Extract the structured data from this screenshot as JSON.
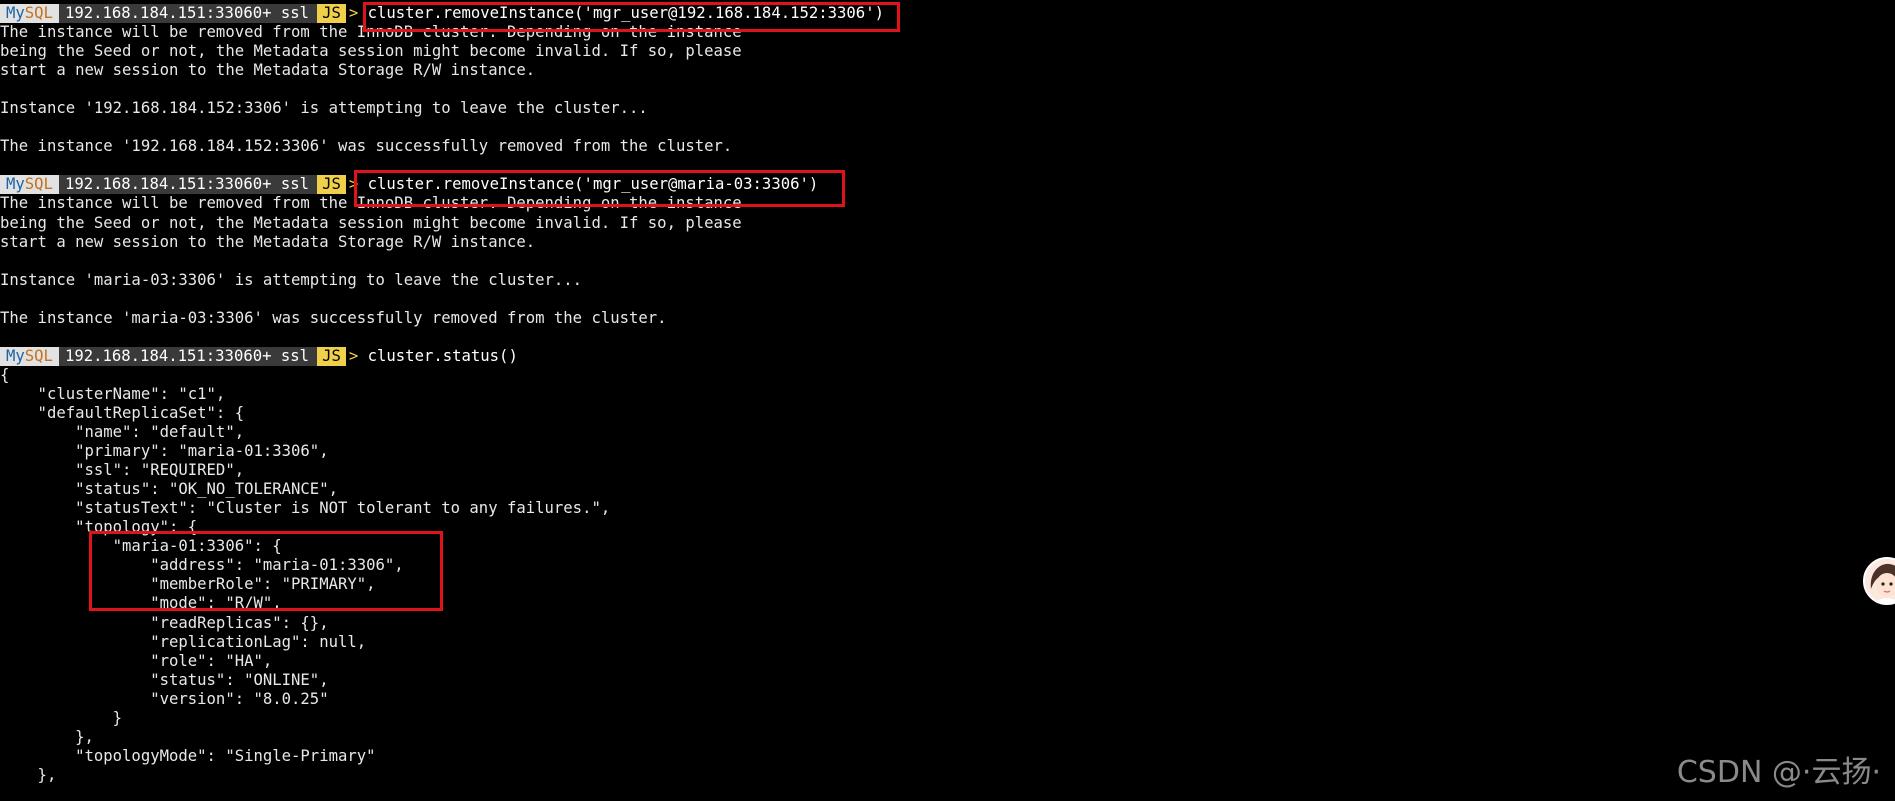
{
  "prompt": {
    "my": "My",
    "sql": "SQL",
    "host": "192.168.184.151:33060+ ssl",
    "lang": "JS",
    "arrow": ">"
  },
  "blocks": [
    {
      "command": " cluster.removeInstance('mgr_user@192.168.184.152:3306')",
      "output": [
        "The instance will be removed from the InnoDB cluster. Depending on the instance",
        "being the Seed or not, the Metadata session might become invalid. If so, please",
        "start a new session to the Metadata Storage R/W instance.",
        "",
        "Instance '192.168.184.152:3306' is attempting to leave the cluster...",
        "",
        "The instance '192.168.184.152:3306' was successfully removed from the cluster.",
        ""
      ]
    },
    {
      "command": " cluster.removeInstance('mgr_user@maria-03:3306')",
      "output": [
        "The instance will be removed from the InnoDB cluster. Depending on the instance",
        "being the Seed or not, the Metadata session might become invalid. If so, please",
        "start a new session to the Metadata Storage R/W instance.",
        "",
        "Instance 'maria-03:3306' is attempting to leave the cluster...",
        "",
        "The instance 'maria-03:3306' was successfully removed from the cluster.",
        ""
      ]
    },
    {
      "command": " cluster.status()",
      "output": [
        "{",
        "    \"clusterName\": \"c1\",",
        "    \"defaultReplicaSet\": {",
        "        \"name\": \"default\",",
        "        \"primary\": \"maria-01:3306\",",
        "        \"ssl\": \"REQUIRED\",",
        "        \"status\": \"OK_NO_TOLERANCE\",",
        "        \"statusText\": \"Cluster is NOT tolerant to any failures.\",",
        "        \"topology\": {",
        "            \"maria-01:3306\": {",
        "                \"address\": \"maria-01:3306\",",
        "                \"memberRole\": \"PRIMARY\",",
        "                \"mode\": \"R/W\",",
        "                \"readReplicas\": {},",
        "                \"replicationLag\": null,",
        "                \"role\": \"HA\",",
        "                \"status\": \"ONLINE\",",
        "                \"version\": \"8.0.25\"",
        "            }",
        "        },",
        "        \"topologyMode\": \"Single-Primary\"",
        "    },"
      ]
    }
  ],
  "watermark": "CSDN @·云扬·",
  "colors": {
    "background": "#000000",
    "text": "#e8e8e8",
    "highlight_box": "#e0121a",
    "prompt_js_bg": "#f0d04a",
    "prompt_host_bg": "#3a3a3a",
    "prompt_mysql_bg": "#e2e2e2"
  },
  "icons": {
    "avatar": "user-avatar-icon"
  }
}
